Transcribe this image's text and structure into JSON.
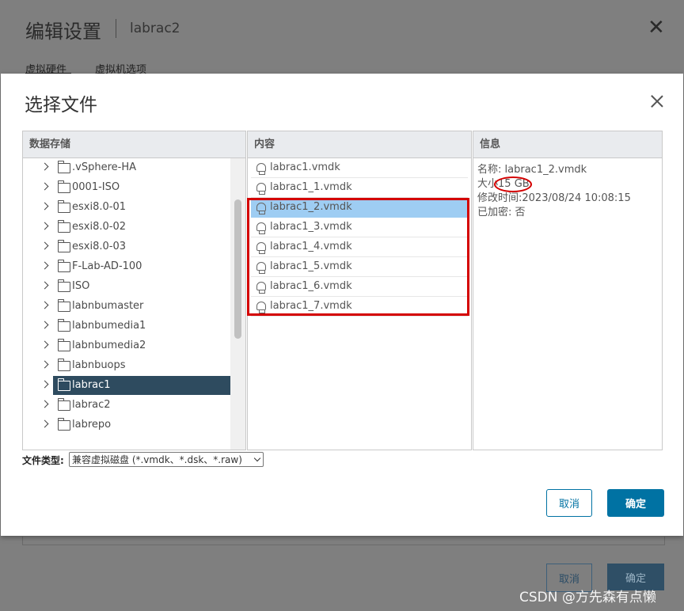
{
  "background": {
    "title": "编辑设置",
    "subtitle": "labrac2",
    "close_glyph": "✕",
    "tabs": [
      "虚拟硬件",
      "虚拟机选项"
    ],
    "cancel_label": "取消",
    "ok_label": "确定"
  },
  "watermark": "CSDN @方先森有点懒",
  "dialog": {
    "title": "选择文件",
    "columns": {
      "datastore": "数据存储",
      "content": "内容",
      "info": "信息"
    },
    "datastores": [
      {
        "label": ".vSphere-HA",
        "selected": false
      },
      {
        "label": "0001-ISO",
        "selected": false
      },
      {
        "label": "esxi8.0-01",
        "selected": false
      },
      {
        "label": "esxi8.0-02",
        "selected": false
      },
      {
        "label": "esxi8.0-03",
        "selected": false
      },
      {
        "label": "F-Lab-AD-100",
        "selected": false
      },
      {
        "label": "ISO",
        "selected": false
      },
      {
        "label": "labnbumaster",
        "selected": false
      },
      {
        "label": "labnbumedia1",
        "selected": false
      },
      {
        "label": "labnbumedia2",
        "selected": false
      },
      {
        "label": "labnbuops",
        "selected": false
      },
      {
        "label": "labrac1",
        "selected": true
      },
      {
        "label": "labrac2",
        "selected": false
      },
      {
        "label": "labrepo",
        "selected": false
      }
    ],
    "files": [
      {
        "label": "labrac1.vmdk",
        "selected": false
      },
      {
        "label": "labrac1_1.vmdk",
        "selected": false
      },
      {
        "label": "labrac1_2.vmdk",
        "selected": true
      },
      {
        "label": "labrac1_3.vmdk",
        "selected": false
      },
      {
        "label": "labrac1_4.vmdk",
        "selected": false
      },
      {
        "label": "labrac1_5.vmdk",
        "selected": false
      },
      {
        "label": "labrac1_6.vmdk",
        "selected": false
      },
      {
        "label": "labrac1_7.vmdk",
        "selected": false
      }
    ],
    "info": {
      "name_label": "名称:",
      "name_value": "labrac1_2.vmdk",
      "size_label": "大小",
      "size_value": "15 GB",
      "modified_label": "修改时间:",
      "modified_value": "2023/08/24 10:08:15",
      "encrypted_label": "已加密:",
      "encrypted_value": "否"
    },
    "file_type_label": "文件类型:",
    "file_type_value": "兼容虚拟磁盘 (*.vmdk、*.dsk、*.raw)",
    "cancel_label": "取消",
    "ok_label": "确定"
  },
  "colors": {
    "selected_tree": "#2e4b5f",
    "selected_file": "#9ecdf3",
    "primary": "#0072a3",
    "annotation": "#d40000"
  }
}
